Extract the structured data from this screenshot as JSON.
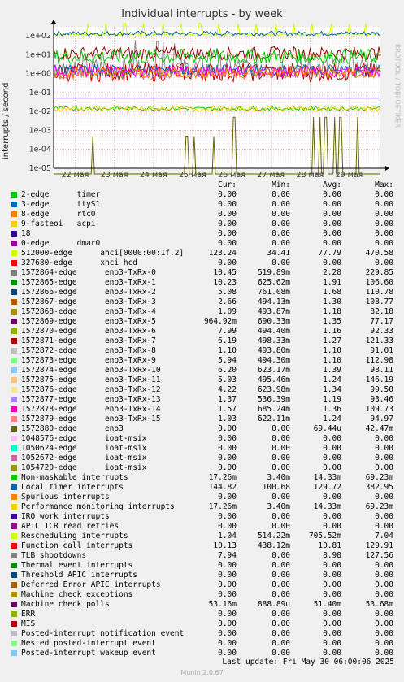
{
  "title": "Individual interrupts - by week",
  "ylabel": "interrupts / second",
  "side_label": "RRDTOOL / TOBI OETIKER",
  "last_update": "Last update: Fri May 30 06:00:06 2025",
  "munin_version": "Munin 2.0.67",
  "headers": [
    "Cur:",
    "Min:",
    "Avg:",
    "Max:"
  ],
  "chart_data": {
    "type": "line",
    "title": "Individual interrupts - by week",
    "ylabel": "interrupts / second",
    "yscale": "log",
    "ylim": [
      1e-05,
      300
    ],
    "y_ticks": [
      {
        "v": 100,
        "label": "1e+02"
      },
      {
        "v": 10,
        "label": "1e+01"
      },
      {
        "v": 1,
        "label": "1e+00"
      },
      {
        "v": 0.1,
        "label": "1e-01"
      },
      {
        "v": 0.01,
        "label": "1e-02"
      },
      {
        "v": 0.001,
        "label": "1e-03"
      },
      {
        "v": 0.0001,
        "label": "1e-04"
      },
      {
        "v": 1e-05,
        "label": "1e-05"
      }
    ],
    "x_labels": [
      "22 мая",
      "23 мая",
      "24 мая",
      "25 мая",
      "26 мая",
      "27 мая",
      "28 мая",
      "29 мая"
    ],
    "grid": true,
    "series": [
      {
        "name": "512000-edge ahci[0000:00:1f.2]",
        "color": "#CCFF00",
        "level": 120,
        "jitter": 0.05,
        "spikes": [
          [
            0.32,
            460
          ],
          [
            0.8,
            460
          ],
          [
            1.27,
            460
          ],
          [
            1.75,
            460
          ],
          [
            2.24,
            460
          ],
          [
            2.71,
            460
          ],
          [
            3.19,
            460
          ],
          [
            3.68,
            460
          ],
          [
            4.16,
            460
          ],
          [
            4.63,
            460
          ],
          [
            5.12,
            460
          ],
          [
            5.58,
            460
          ],
          [
            6.05,
            460
          ],
          [
            6.55,
            460
          ],
          [
            7.02,
            460
          ],
          [
            7.43,
            460
          ]
        ]
      },
      {
        "name": "Local timer interrupts",
        "color": "#0066B3",
        "level": 135,
        "jitter": 0.12,
        "spikes": []
      },
      {
        "name": "1572864-edge eno3-TxRx-0",
        "color": "#888888",
        "level": 2,
        "jitter": 0.6,
        "spikes": [
          [
            1.55,
            60
          ],
          [
            2.1,
            50
          ],
          [
            2.25,
            45
          ],
          [
            2.55,
            40
          ]
        ]
      },
      {
        "name": "1572880-edge eno3",
        "color": "#666600",
        "level": 1e-07,
        "jitter": 0,
        "spikes": [
          [
            0.45,
            0.0005
          ],
          [
            2.85,
            0.0005
          ],
          [
            3.05,
            0.0005
          ],
          [
            3.53,
            0.0005
          ],
          [
            4.06,
            0.005
          ],
          [
            6.08,
            0.005
          ],
          [
            6.25,
            0.005
          ],
          [
            6.4,
            0.005
          ],
          [
            6.62,
            0.005
          ],
          [
            6.78,
            0.005
          ],
          [
            7.2,
            0.005
          ]
        ]
      },
      {
        "name": "Rescheduling interrupts",
        "color": "#CC0000",
        "level": 1.2,
        "jitter": 0.5,
        "spikes": []
      },
      {
        "name": "Function call interrupts",
        "color": "#990000",
        "level": 12,
        "jitter": 0.35,
        "spikes": []
      },
      {
        "name": "TLB shootdowns",
        "color": "#00CC00",
        "level": 8,
        "jitter": 0.4,
        "spikes": []
      },
      {
        "name": "Machine check polls",
        "color": "#330099",
        "level": 0.0514,
        "jitter": 0.0,
        "spikes": []
      },
      {
        "name": "Non-maskable interrupts",
        "color": "#00CC00",
        "level": 0.0143,
        "jitter": 0.1,
        "spikes": []
      },
      {
        "name": "Performance monitoring interrupts",
        "color": "#FFCC00",
        "level": 0.014,
        "jitter": 0.15,
        "spikes": []
      },
      {
        "name": "1572865-edge eno3-TxRx-1",
        "color": "#0066B3",
        "level": 1.5,
        "jitter": 0.3,
        "spikes": []
      },
      {
        "name": "1572869-edge eno3-TxRx-5",
        "color": "#FF00FF",
        "level": 1.3,
        "jitter": 0.3,
        "spikes": []
      },
      {
        "name": "1572872-edge eno3-TxRx-8",
        "color": "#FF8000",
        "level": 1.1,
        "jitter": 0.3,
        "spikes": []
      }
    ]
  },
  "legend": [
    {
      "color": "#00CC00",
      "name": "2-edge      timer",
      "cur": "0.00",
      "min": "0.00",
      "avg": "0.00",
      "max": "0.00"
    },
    {
      "color": "#0066B3",
      "name": "3-edge      ttyS1",
      "cur": "0.00",
      "min": "0.00",
      "avg": "0.00",
      "max": "0.00"
    },
    {
      "color": "#FF8000",
      "name": "8-edge      rtc0",
      "cur": "0.00",
      "min": "0.00",
      "avg": "0.00",
      "max": "0.00"
    },
    {
      "color": "#FFCC00",
      "name": "9-fasteoi   acpi",
      "cur": "0.00",
      "min": "0.00",
      "avg": "0.00",
      "max": "0.00"
    },
    {
      "color": "#330099",
      "name": "18",
      "cur": "0.00",
      "min": "0.00",
      "avg": "0.00",
      "max": "0.00"
    },
    {
      "color": "#990099",
      "name": "0-edge      dmar0",
      "cur": "0.00",
      "min": "0.00",
      "avg": "0.00",
      "max": "0.00"
    },
    {
      "color": "#CCFF00",
      "name": "512000-edge      ahci[0000:00:1f.2]",
      "cur": "123.24",
      "min": "34.41",
      "avg": "77.79",
      "max": "470.58"
    },
    {
      "color": "#FF0000",
      "name": "327680-edge      xhci_hcd",
      "cur": "0.00",
      "min": "0.00",
      "avg": "0.00",
      "max": "0.00"
    },
    {
      "color": "#808080",
      "name": "1572864-edge      eno3-TxRx-0",
      "cur": "10.45",
      "min": "519.89m",
      "avg": "2.28",
      "max": "229.85"
    },
    {
      "color": "#008F00",
      "name": "1572865-edge      eno3-TxRx-1",
      "cur": "10.23",
      "min": "625.62m",
      "avg": "1.91",
      "max": "106.60"
    },
    {
      "color": "#00487D",
      "name": "1572866-edge      eno3-TxRx-2",
      "cur": "5.08",
      "min": "761.08m",
      "avg": "1.68",
      "max": "110.78"
    },
    {
      "color": "#B35A00",
      "name": "1572867-edge      eno3-TxRx-3",
      "cur": "2.66",
      "min": "494.13m",
      "avg": "1.30",
      "max": "108.77"
    },
    {
      "color": "#B38F00",
      "name": "1572868-edge      eno3-TxRx-4",
      "cur": "1.09",
      "min": "493.87m",
      "avg": "1.18",
      "max": "82.18"
    },
    {
      "color": "#6B006B",
      "name": "1572869-edge      eno3-TxRx-5",
      "cur": "964.92m",
      "min": "690.33m",
      "avg": "1.35",
      "max": "77.17"
    },
    {
      "color": "#8FB300",
      "name": "1572870-edge      eno3-TxRx-6",
      "cur": "7.99",
      "min": "494.40m",
      "avg": "1.16",
      "max": "92.33"
    },
    {
      "color": "#B30000",
      "name": "1572871-edge      eno3-TxRx-7",
      "cur": "6.19",
      "min": "498.33m",
      "avg": "1.27",
      "max": "121.33"
    },
    {
      "color": "#BEBEBE",
      "name": "1572872-edge      eno3-TxRx-8",
      "cur": "1.10",
      "min": "493.80m",
      "avg": "1.10",
      "max": "91.01"
    },
    {
      "color": "#80FF80",
      "name": "1572873-edge      eno3-TxRx-9",
      "cur": "5.94",
      "min": "494.30m",
      "avg": "1.10",
      "max": "112.98"
    },
    {
      "color": "#80C9FF",
      "name": "1572874-edge      eno3-TxRx-10",
      "cur": "6.20",
      "min": "623.17m",
      "avg": "1.39",
      "max": "98.11"
    },
    {
      "color": "#FFC080",
      "name": "1572875-edge      eno3-TxRx-11",
      "cur": "5.03",
      "min": "495.46m",
      "avg": "1.24",
      "max": "146.19"
    },
    {
      "color": "#FFE680",
      "name": "1572876-edge      eno3-TxRx-12",
      "cur": "4.22",
      "min": "623.98m",
      "avg": "1.34",
      "max": "99.50"
    },
    {
      "color": "#AA80FF",
      "name": "1572877-edge      eno3-TxRx-13",
      "cur": "1.37",
      "min": "536.39m",
      "avg": "1.19",
      "max": "93.46"
    },
    {
      "color": "#EE00CC",
      "name": "1572878-edge      eno3-TxRx-14",
      "cur": "1.57",
      "min": "685.24m",
      "avg": "1.36",
      "max": "109.73"
    },
    {
      "color": "#FF8080",
      "name": "1572879-edge      eno3-TxRx-15",
      "cur": "1.03",
      "min": "622.11m",
      "avg": "1.24",
      "max": "94.97"
    },
    {
      "color": "#666600",
      "name": "1572880-edge      eno3",
      "cur": "0.00",
      "min": "0.00",
      "avg": "69.44u",
      "max": "42.47m"
    },
    {
      "color": "#FFBFFF",
      "name": "1048576-edge      ioat-msix",
      "cur": "0.00",
      "min": "0.00",
      "avg": "0.00",
      "max": "0.00"
    },
    {
      "color": "#00FFCC",
      "name": "1050624-edge      ioat-msix",
      "cur": "0.00",
      "min": "0.00",
      "avg": "0.00",
      "max": "0.00"
    },
    {
      "color": "#CC6699",
      "name": "1052672-edge      ioat-msix",
      "cur": "0.00",
      "min": "0.00",
      "avg": "0.00",
      "max": "0.00"
    },
    {
      "color": "#999900",
      "name": "1054720-edge      ioat-msix",
      "cur": "0.00",
      "min": "0.00",
      "avg": "0.00",
      "max": "0.00"
    },
    {
      "color": "#00CC00",
      "name": "Non-maskable interrupts",
      "cur": "17.26m",
      "min": "3.40m",
      "avg": "14.33m",
      "max": "69.23m"
    },
    {
      "color": "#0066B3",
      "name": "Local timer interrupts",
      "cur": "144.82",
      "min": "100.68",
      "avg": "129.72",
      "max": "382.95"
    },
    {
      "color": "#FF8000",
      "name": "Spurious interrupts",
      "cur": "0.00",
      "min": "0.00",
      "avg": "0.00",
      "max": "0.00"
    },
    {
      "color": "#FFCC00",
      "name": "Performance monitoring interrupts",
      "cur": "17.26m",
      "min": "3.40m",
      "avg": "14.33m",
      "max": "69.23m"
    },
    {
      "color": "#330099",
      "name": "IRQ work interrupts",
      "cur": "0.00",
      "min": "0.00",
      "avg": "0.00",
      "max": "0.00"
    },
    {
      "color": "#990099",
      "name": "APIC ICR read retries",
      "cur": "0.00",
      "min": "0.00",
      "avg": "0.00",
      "max": "0.00"
    },
    {
      "color": "#CCFF00",
      "name": "Rescheduling interrupts",
      "cur": "1.04",
      "min": "514.22m",
      "avg": "705.52m",
      "max": "7.04"
    },
    {
      "color": "#FF0000",
      "name": "Function call interrupts",
      "cur": "10.13",
      "min": "438.12m",
      "avg": "10.81",
      "max": "129.91"
    },
    {
      "color": "#808080",
      "name": "TLB shootdowns",
      "cur": "7.94",
      "min": "0.00",
      "avg": "8.98",
      "max": "127.56"
    },
    {
      "color": "#008F00",
      "name": "Thermal event interrupts",
      "cur": "0.00",
      "min": "0.00",
      "avg": "0.00",
      "max": "0.00"
    },
    {
      "color": "#00487D",
      "name": "Threshold APIC interrupts",
      "cur": "0.00",
      "min": "0.00",
      "avg": "0.00",
      "max": "0.00"
    },
    {
      "color": "#B35A00",
      "name": "Deferred Error APIC interrupts",
      "cur": "0.00",
      "min": "0.00",
      "avg": "0.00",
      "max": "0.00"
    },
    {
      "color": "#B38F00",
      "name": "Machine check exceptions",
      "cur": "0.00",
      "min": "0.00",
      "avg": "0.00",
      "max": "0.00"
    },
    {
      "color": "#6B006B",
      "name": "Machine check polls",
      "cur": "53.16m",
      "min": "888.89u",
      "avg": "51.40m",
      "max": "53.68m"
    },
    {
      "color": "#8FB300",
      "name": "ERR",
      "cur": "0.00",
      "min": "0.00",
      "avg": "0.00",
      "max": "0.00"
    },
    {
      "color": "#B30000",
      "name": "MIS",
      "cur": "0.00",
      "min": "0.00",
      "avg": "0.00",
      "max": "0.00"
    },
    {
      "color": "#BEBEBE",
      "name": "Posted-interrupt notification event",
      "cur": "0.00",
      "min": "0.00",
      "avg": "0.00",
      "max": "0.00"
    },
    {
      "color": "#80FF80",
      "name": "Nested posted-interrupt event",
      "cur": "0.00",
      "min": "0.00",
      "avg": "0.00",
      "max": "0.00"
    },
    {
      "color": "#80C9FF",
      "name": "Posted-interrupt wakeup event",
      "cur": "0.00",
      "min": "0.00",
      "avg": "0.00",
      "max": "0.00"
    }
  ]
}
